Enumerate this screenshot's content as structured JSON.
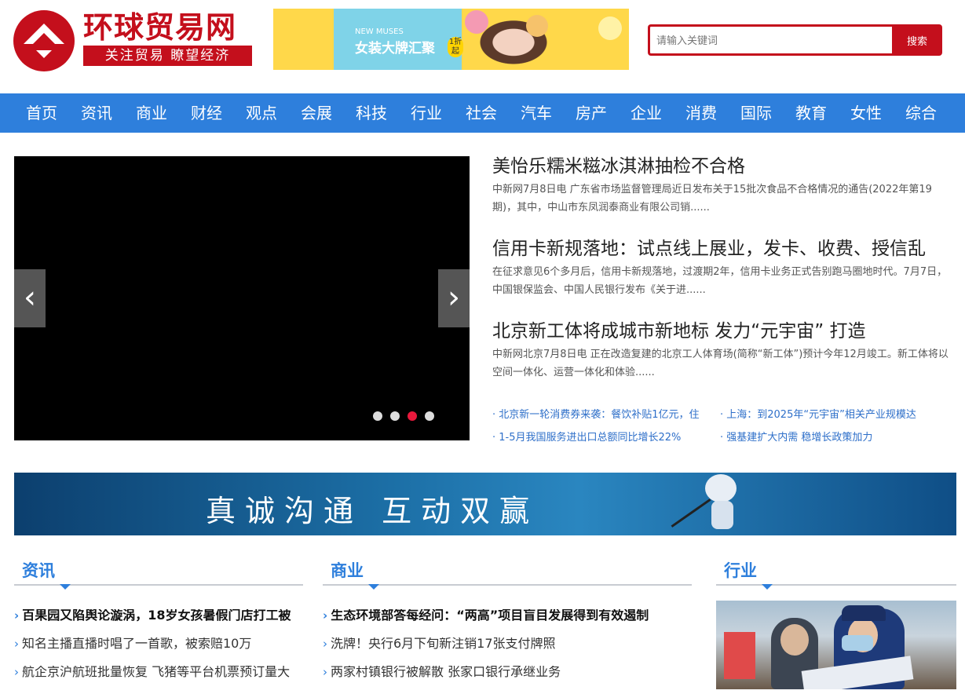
{
  "header": {
    "site_title": "环球贸易网",
    "slogan": "关注贸易 瞭望经济",
    "search": {
      "placeholder": "请输入关键词",
      "button": "搜索"
    },
    "ad": {
      "en": "NEW MUSES",
      "cn": "女装大牌汇聚",
      "badge": "1折起"
    }
  },
  "nav": [
    "首页",
    "资讯",
    "商业",
    "财经",
    "观点",
    "会展",
    "科技",
    "行业",
    "社会",
    "汽车",
    "房产",
    "企业",
    "消费",
    "国际",
    "教育",
    "女性",
    "综合"
  ],
  "slider": {
    "prev": "‹",
    "next": "›",
    "dots": 4,
    "active_dot": 3
  },
  "headlines": [
    {
      "title": "美怡乐糯米糍冰淇淋抽检不合格",
      "desc": "中新网7月8日电 广东省市场监督管理局近日发布关于15批次食品不合格情况的通告(2022年第19期)，其中，中山市东凤润泰商业有限公司销......"
    },
    {
      "title": "信用卡新规落地：试点线上展业，发卡、收费、授信乱",
      "desc": "在征求意见6个多月后，信用卡新规落地，过渡期2年，信用卡业务正式告别跑马圈地时代。7月7日，中国银保监会、中国人民银行发布《关于进......"
    },
    {
      "title": "北京新工体将成城市新地标 发力“元宇宙” 打造",
      "desc": "中新网北京7月8日电 正在改造复建的北京工人体育场(简称“新工体”)预计今年12月竣工。新工体将以空间一体化、运营一体化和体验......"
    }
  ],
  "quick_links": [
    [
      "· 北京新一轮消费券来袭：餐饮补贴1亿元，住",
      "· 上海：到2025年“元宇宙”相关产业规模达"
    ],
    [
      "· 1-5月我国服务进出口总额同比增长22%",
      "· 强基建扩大内需 稳增长政策加力"
    ]
  ],
  "banner": {
    "text": "真诚沟通 互动双赢"
  },
  "columns": [
    {
      "title": "资讯",
      "items": [
        "百果园又陷舆论漩涡，18岁女孩暑假门店打工被",
        "知名主播直播时唱了一首歌，被索赔10万",
        "航企京沪航班批量恢复 飞猪等平台机票预订量大"
      ]
    },
    {
      "title": "商业",
      "items": [
        "生态环境部答每经问：“两高”项目盲目发展得到有效遏制",
        "洗牌！央行6月下旬新注销17张支付牌照",
        "两家村镇银行被解散 张家口银行承继业务"
      ]
    },
    {
      "title": "行业",
      "items": []
    }
  ]
}
